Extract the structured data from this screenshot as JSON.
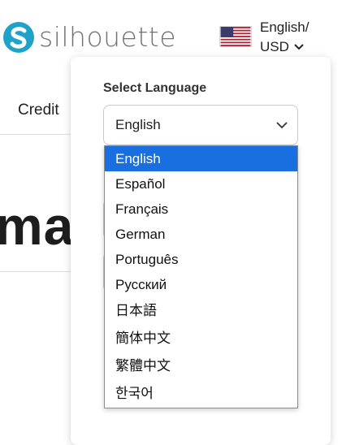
{
  "header": {
    "logo_text": "silhouette",
    "locale_language": "English/",
    "locale_currency": "USD"
  },
  "background": {
    "nav_credit": "Credit",
    "headline_fragment": "mat"
  },
  "language_popup": {
    "title": "Select Language",
    "selected_value": "English",
    "options": [
      {
        "label": "English",
        "selected": true
      },
      {
        "label": "Español",
        "selected": false
      },
      {
        "label": "Français",
        "selected": false
      },
      {
        "label": "German",
        "selected": false
      },
      {
        "label": "Português",
        "selected": false
      },
      {
        "label": "Русский",
        "selected": false
      },
      {
        "label": "日本語",
        "selected": false
      },
      {
        "label": "簡体中文",
        "selected": false
      },
      {
        "label": "繁體中文",
        "selected": false
      },
      {
        "label": "한국어",
        "selected": false
      }
    ]
  },
  "colors": {
    "brand_teal": "#1fa2c8",
    "selected_option": "#1a6fe0"
  },
  "icons": [
    "silhouette-logo-icon",
    "us-flag-icon",
    "chevron-down-icon"
  ]
}
